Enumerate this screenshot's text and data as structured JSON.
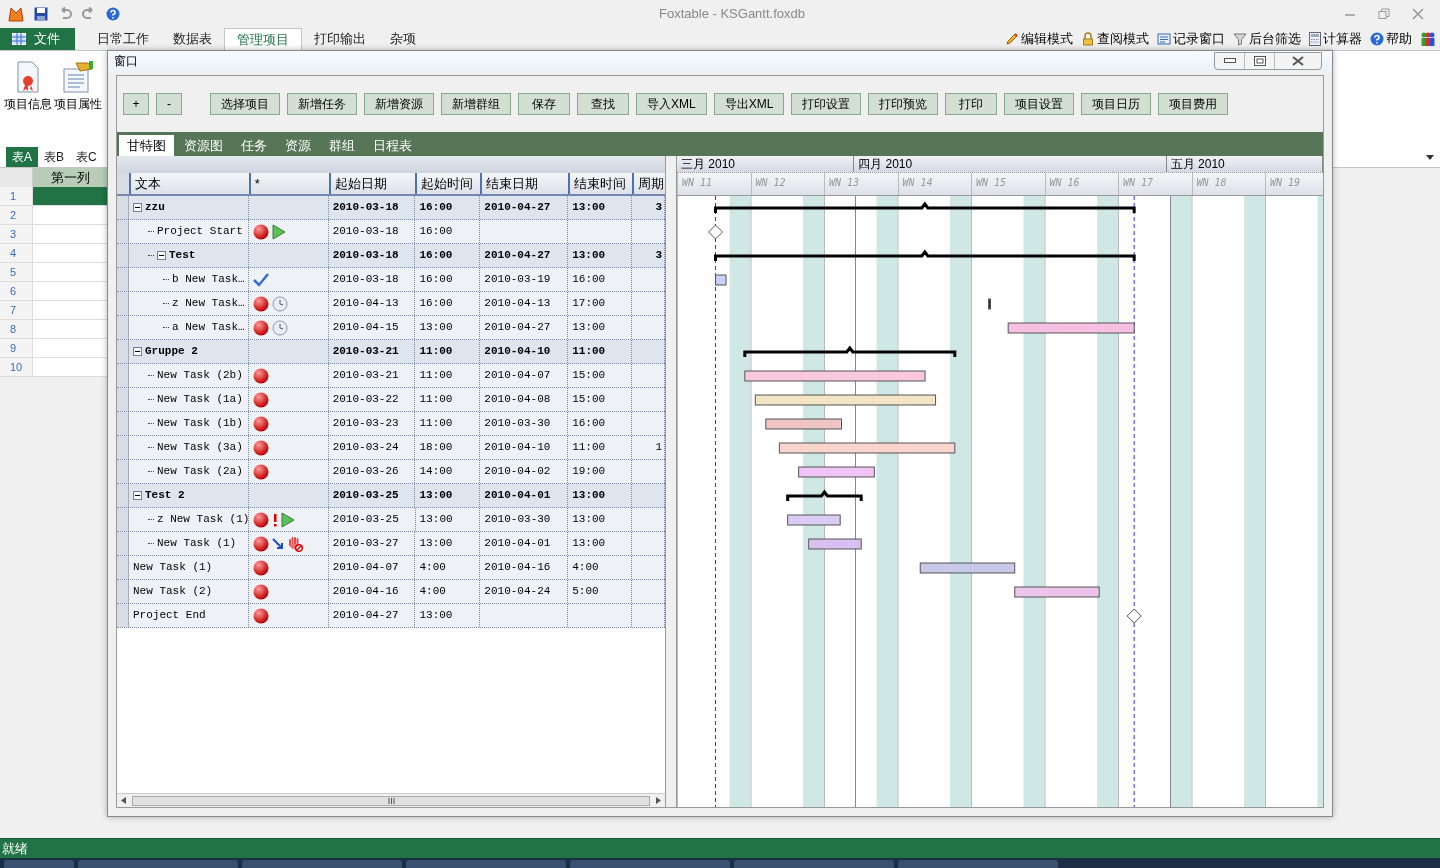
{
  "title_bar": {
    "title": "Foxtable - KSGantt.foxdb"
  },
  "ribbon": {
    "file_button": "文件",
    "tabs": [
      {
        "label": "日常工作",
        "selected": false
      },
      {
        "label": "数据表",
        "selected": false
      },
      {
        "label": "管理项目",
        "selected": true
      },
      {
        "label": "打印输出",
        "selected": false
      },
      {
        "label": "杂项",
        "selected": false
      }
    ],
    "right_items": [
      {
        "kind": "pencil",
        "label": "编辑模式"
      },
      {
        "kind": "lock",
        "label": "查阅模式"
      },
      {
        "kind": "form",
        "label": "记录窗口"
      },
      {
        "kind": "filter",
        "label": "后台筛选"
      },
      {
        "kind": "calculator",
        "label": "计算器"
      },
      {
        "kind": "help",
        "label": "帮助"
      }
    ],
    "buttons": [
      {
        "kind": "certificate",
        "label": "项目信息"
      },
      {
        "kind": "document",
        "label": "项目属性"
      }
    ]
  },
  "sheet": {
    "tabs": [
      {
        "label": "表A",
        "selected": true
      },
      {
        "label": "表B",
        "selected": false
      },
      {
        "label": "表C",
        "selected": false
      }
    ],
    "column": "第一列",
    "rows": [
      {
        "number": "1",
        "selected": true
      },
      {
        "number": "2",
        "selected": false
      },
      {
        "number": "3",
        "selected": false
      },
      {
        "number": "4",
        "selected": false
      },
      {
        "number": "5",
        "selected": false
      },
      {
        "number": "6",
        "selected": false
      },
      {
        "number": "7",
        "selected": false
      },
      {
        "number": "8",
        "selected": false
      },
      {
        "number": "9",
        "selected": false
      },
      {
        "number": "10",
        "selected": false
      }
    ]
  },
  "dialog": {
    "title": "窗口",
    "small_buttons": [
      "+",
      "-"
    ],
    "buttons": [
      "选择项目",
      "新增任务",
      "新增资源",
      "新增群组",
      "保存",
      "查找",
      "导入XML",
      "导出XML",
      "打印设置",
      "打印预览",
      "打印",
      "项目设置",
      "项目日历",
      "项目费用"
    ],
    "tabs": [
      {
        "label": "甘特图",
        "selected": true
      },
      {
        "label": "资源图",
        "selected": false
      },
      {
        "label": "任务",
        "selected": false
      },
      {
        "label": "资源",
        "selected": false
      },
      {
        "label": "群组",
        "selected": false
      },
      {
        "label": "日程表",
        "selected": false
      }
    ],
    "table": {
      "columns": [
        "文本",
        "*",
        "起始日期",
        "起始时间",
        "结束日期",
        "结束时间",
        "周期"
      ],
      "rows": [
        {
          "kind": "summary",
          "name": "zzu",
          "expanded": true,
          "start_date": "2010-03-18",
          "start_time": "16:00",
          "end_date": "2010-04-27",
          "end_time": "13:00",
          "duration": "3",
          "children": [
            {
              "kind": "milestone",
              "name": "Project Start",
              "icons": [
                {
                  "kind": "ball"
                },
                {
                  "kind": "play"
                }
              ],
              "start_date": "2010-03-18",
              "start_time": "16:00"
            },
            {
              "kind": "summary",
              "name": "Test",
              "expanded": true,
              "start_date": "2010-03-18",
              "start_time": "16:00",
              "end_date": "2010-04-27",
              "end_time": "13:00",
              "duration": "3",
              "children": [
                {
                  "kind": "task",
                  "name": "b New Task…",
                  "icons": [
                    {
                      "kind": "check"
                    }
                  ],
                  "start_date": "2010-03-18",
                  "start_time": "16:00",
                  "end_date": "2010-03-19",
                  "end_time": "16:00",
                  "color": "#c8d0f8"
                },
                {
                  "kind": "task",
                  "name": "z New Task…",
                  "icons": [
                    {
                      "kind": "ball"
                    },
                    {
                      "kind": "clock"
                    }
                  ],
                  "start_date": "2010-04-13",
                  "start_time": "16:00",
                  "end_date": "2010-04-13",
                  "end_time": "17:00",
                  "color": "#2020e0"
                },
                {
                  "kind": "task",
                  "name": "a New Task…",
                  "icons": [
                    {
                      "kind": "ball"
                    },
                    {
                      "kind": "clock"
                    }
                  ],
                  "start_date": "2010-04-15",
                  "start_time": "13:00",
                  "end_date": "2010-04-27",
                  "end_time": "13:00",
                  "color": "#f8c0e0"
                }
              ]
            }
          ]
        },
        {
          "kind": "summary",
          "name": "Gruppe 2",
          "expanded": true,
          "start_date": "2010-03-21",
          "start_time": "11:00",
          "end_date": "2010-04-10",
          "end_time": "11:00",
          "children": [
            {
              "kind": "task",
              "name": "New Task (2b)",
              "icons": [
                {
                  "kind": "ball"
                }
              ],
              "start_date": "2010-03-21",
              "start_time": "11:00",
              "end_date": "2010-04-07",
              "end_time": "15:00",
              "color": "#f8c8dc"
            },
            {
              "kind": "task",
              "name": "New Task (1a)",
              "icons": [
                {
                  "kind": "ball"
                }
              ],
              "start_date": "2010-03-22",
              "start_time": "11:00",
              "end_date": "2010-04-08",
              "end_time": "15:00",
              "color": "#f2e4c4"
            },
            {
              "kind": "task",
              "name": "New Task (1b)",
              "icons": [
                {
                  "kind": "ball"
                }
              ],
              "start_date": "2010-03-23",
              "start_time": "11:00",
              "end_date": "2010-03-30",
              "end_time": "16:00",
              "color": "#eec4c4"
            },
            {
              "kind": "task",
              "name": "New Task (3a)",
              "icons": [
                {
                  "kind": "ball"
                }
              ],
              "start_date": "2010-03-24",
              "start_time": "18:00",
              "end_date": "2010-04-10",
              "end_time": "11:00",
              "duration": "1",
              "color": "#f8d4cc"
            },
            {
              "kind": "task",
              "name": "New Task (2a)",
              "icons": [
                {
                  "kind": "ball"
                }
              ],
              "start_date": "2010-03-26",
              "start_time": "14:00",
              "end_date": "2010-04-02",
              "end_time": "19:00",
              "color": "#f0c4f4"
            }
          ]
        },
        {
          "kind": "summary",
          "name": "Test 2",
          "expanded": true,
          "start_date": "2010-03-25",
          "start_time": "13:00",
          "end_date": "2010-04-01",
          "end_time": "13:00",
          "children": [
            {
              "kind": "task",
              "name": "z New Task (1)",
              "icons": [
                {
                  "kind": "ball"
                },
                {
                  "kind": "exclamation"
                },
                {
                  "kind": "play"
                }
              ],
              "start_date": "2010-03-25",
              "start_time": "13:00",
              "end_date": "2010-03-30",
              "end_time": "13:00",
              "color": "#dcccf4"
            },
            {
              "kind": "task",
              "name": "New Task (1)",
              "icons": [
                {
                  "kind": "ball"
                },
                {
                  "kind": "arrow"
                },
                {
                  "kind": "hand"
                }
              ],
              "start_date": "2010-03-27",
              "start_time": "13:00",
              "end_date": "2010-04-01",
              "end_time": "13:00",
              "color": "#d8c0f0"
            }
          ]
        },
        {
          "kind": "task",
          "name": "New Task (1)",
          "icons": [
            {
              "kind": "ball"
            }
          ],
          "start_date": "2010-04-07",
          "start_time": "4:00",
          "end_date": "2010-04-16",
          "end_time": "4:00",
          "color": "#c8c8e8"
        },
        {
          "kind": "task",
          "name": "New Task (2)",
          "icons": [
            {
              "kind": "ball"
            }
          ],
          "start_date": "2010-04-16",
          "start_time": "4:00",
          "end_date": "2010-04-24",
          "end_time": "5:00",
          "color": "#ecc4ec"
        },
        {
          "kind": "milestone",
          "name": "Project End",
          "icons": [
            {
              "kind": "ball"
            }
          ],
          "start_date": "2010-04-27",
          "start_time": "13:00"
        }
      ]
    },
    "gantt": {
      "months": [
        "三月 2010",
        "四月 2010",
        "五月 2010"
      ],
      "weeks": [
        "WN 11",
        "WN 12",
        "WN 13",
        "WN 14",
        "WN 15",
        "WN 16",
        "WN 17",
        "WN 18",
        "WN 19"
      ]
    }
  },
  "status_bar": {
    "text": "就绪"
  }
}
